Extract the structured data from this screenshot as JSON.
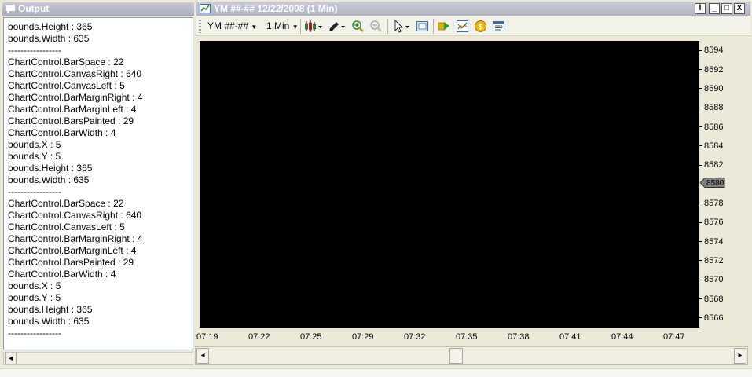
{
  "output_panel": {
    "title": "Output",
    "lines": [
      "bounds.Height : 365",
      "bounds.Width : 635",
      "-----------------",
      "ChartControl.BarSpace : 22",
      "ChartControl.CanvasRight : 640",
      "ChartControl.CanvasLeft : 5",
      "ChartControl.BarMarginRight : 4",
      "ChartControl.BarMarginLeft : 4",
      "ChartControl.BarsPainted : 29",
      "ChartControl.BarWidth : 4",
      "bounds.X : 5",
      "bounds.Y : 5",
      "bounds.Height : 365",
      "bounds.Width : 635",
      "-----------------",
      "ChartControl.BarSpace : 22",
      "ChartControl.CanvasRight : 640",
      "ChartControl.CanvasLeft : 5",
      "ChartControl.BarMarginRight : 4",
      "ChartControl.BarMarginLeft : 4",
      "ChartControl.BarsPainted : 29",
      "ChartControl.BarWidth : 4",
      "bounds.X : 5",
      "bounds.Y : 5",
      "bounds.Height : 365",
      "bounds.Width : 635",
      "-----------------"
    ]
  },
  "chart_window": {
    "title": "YM ##-##  12/22/2008 (1 Min)",
    "buttons": {
      "minimize": "_",
      "maximize": "□",
      "close": "X"
    },
    "toolbar": {
      "instrument": "YM ##-##",
      "interval": "1 Min",
      "icons": [
        "bar-type-icon",
        "drawing-tool-icon",
        "zoom-in-icon",
        "zoom-out-icon",
        "pointer-icon",
        "data-box-icon",
        "strategies-icon",
        "indicators-icon",
        "orders-icon",
        "properties-icon"
      ]
    },
    "price_marker": "8580",
    "colors": {
      "plot_background": "#000000",
      "marker": "#808080"
    }
  },
  "chart_data": {
    "type": "line",
    "title": "",
    "xlabel": "",
    "ylabel": "",
    "y_ticks": [
      "8594",
      "8592",
      "8590",
      "8588",
      "8586",
      "8584",
      "8582",
      "8580",
      "8578",
      "8576",
      "8574",
      "8572",
      "8570",
      "8568",
      "8566"
    ],
    "x_ticks": [
      "07:19",
      "07:22",
      "07:25",
      "07:29",
      "07:32",
      "07:35",
      "07:38",
      "07:41",
      "07:44",
      "07:47"
    ],
    "ylim": [
      8565,
      8595
    ],
    "series": []
  }
}
